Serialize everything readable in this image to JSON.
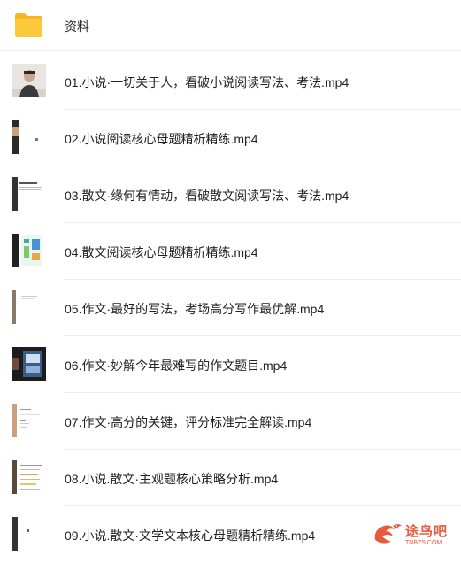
{
  "folder": {
    "name": "资料",
    "icon": "folder-icon"
  },
  "files": [
    {
      "name": "01.小说·一切关于人，看破小说阅读写法、考法.mp4",
      "thumb": "person-video"
    },
    {
      "name": "02.小说阅读核心母题精析精练.mp4",
      "thumb": "document"
    },
    {
      "name": "03.散文·缘何有情动，看破散文阅读写法、考法.mp4",
      "thumb": "document"
    },
    {
      "name": "04.散文阅读核心母题精析精练.mp4",
      "thumb": "colorful-slide"
    },
    {
      "name": "05.作文·最好的写法，考场高分写作最优解.mp4",
      "thumb": "document"
    },
    {
      "name": "06.作文·妙解今年最难写的作文题目.mp4",
      "thumb": "dark-slide"
    },
    {
      "name": "07.作文·高分的关键，评分标准完全解读.mp4",
      "thumb": "document"
    },
    {
      "name": "08.小说.散文·主观题核心策略分析.mp4",
      "thumb": "document"
    },
    {
      "name": "09.小说.散文·文学文本核心母题精析精练.mp4",
      "thumb": "document"
    }
  ],
  "watermark": {
    "text": "途鸟吧",
    "sub": "TNBZS.COM",
    "color": "#e85a3c"
  },
  "colors": {
    "folder": "#f7c12e",
    "text": "#222222",
    "divider": "#ececec"
  }
}
